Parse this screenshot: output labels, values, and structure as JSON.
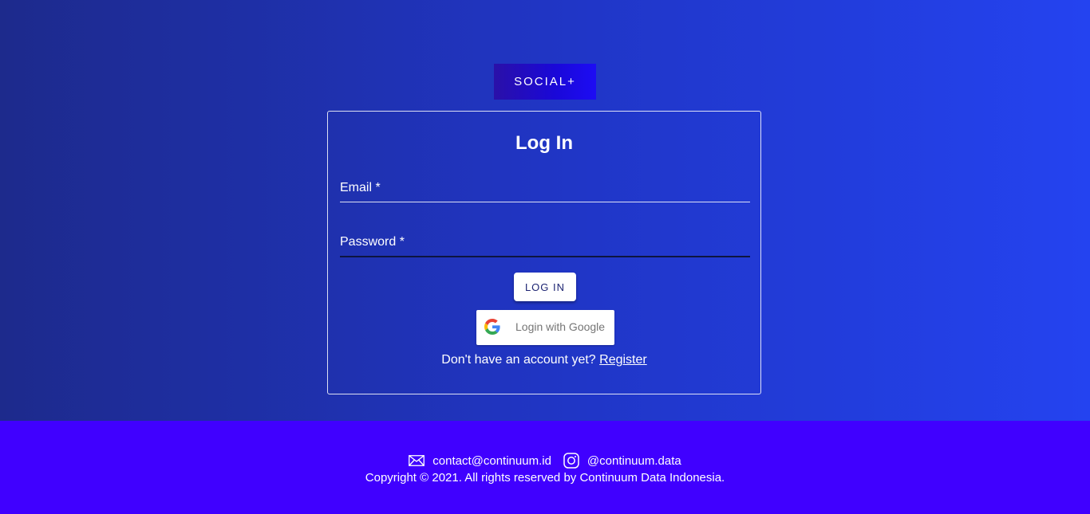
{
  "logo": {
    "text": "SOCIAL+"
  },
  "login_card": {
    "title": "Log In",
    "email_label": "Email *",
    "password_label": "Password *",
    "login_button": "LOG IN",
    "google_button": "Login with Google",
    "register_prompt": "Don't have an account yet?",
    "register_link": "Register"
  },
  "footer": {
    "email": "contact@continuum.id",
    "instagram": "@continuum.data",
    "copyright": "Copyright © 2021. All rights reserved by Continuum Data Indonesia."
  },
  "colors": {
    "footer_bg": "#4000ff",
    "hero_gradient_start": "#1d2a8c",
    "hero_gradient_end": "#2443f0"
  },
  "icons": {
    "email": "mail-icon",
    "instagram": "instagram-icon",
    "google": "google-icon"
  }
}
